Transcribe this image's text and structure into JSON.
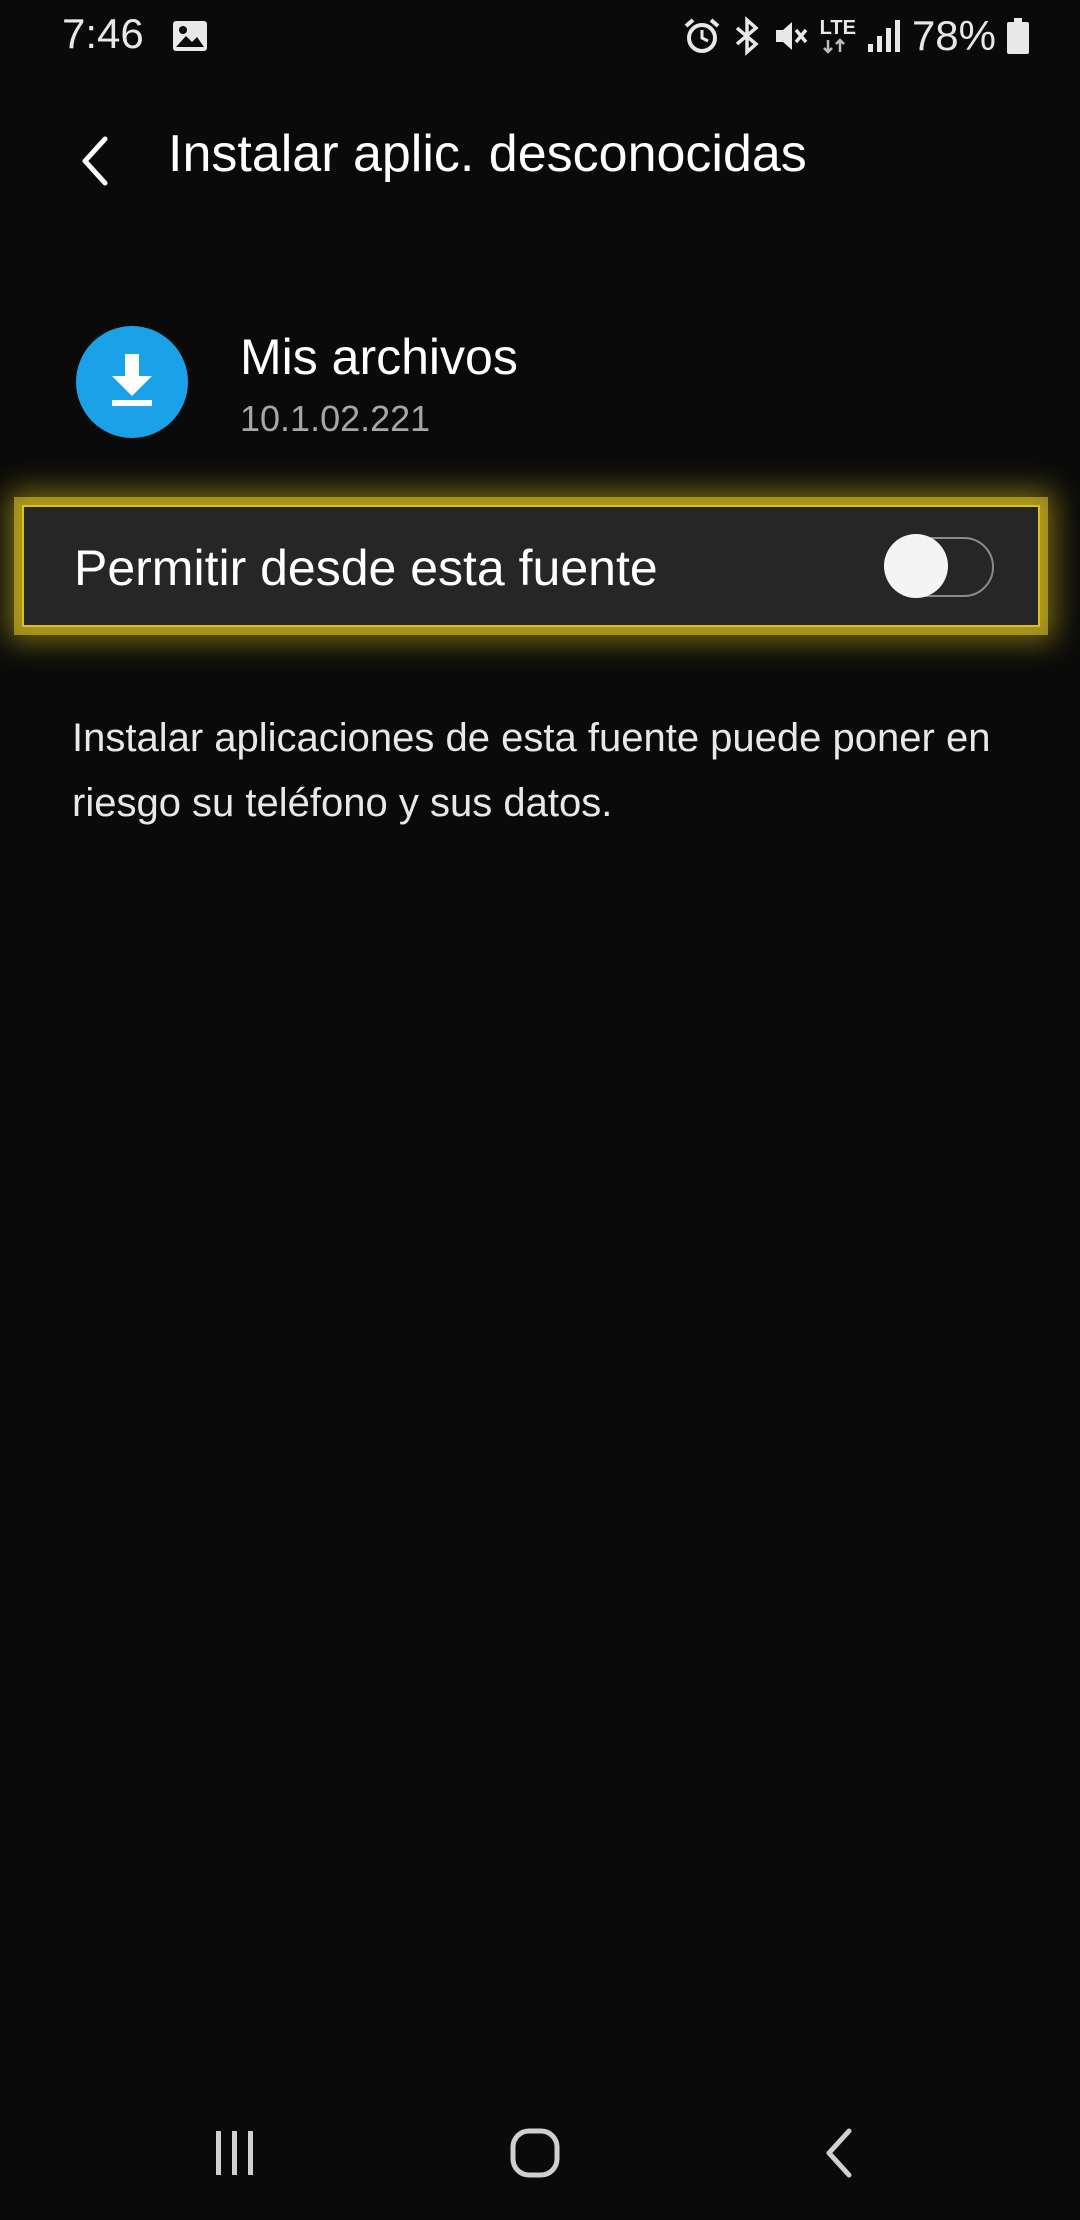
{
  "status_bar": {
    "time": "7:46",
    "network": "LTE",
    "battery": "78%",
    "icons": [
      "gallery-icon",
      "alarm-icon",
      "bluetooth-icon",
      "mute-icon",
      "lte-icon",
      "signal-icon",
      "battery-icon"
    ]
  },
  "header": {
    "title": "Instalar aplic. desconocidas",
    "back_icon": "back-arrow-icon"
  },
  "app": {
    "name": "Mis archivos",
    "version": "10.1.02.221",
    "icon": "download-icon",
    "icon_color": "#1ba1e8"
  },
  "permission": {
    "label": "Permitir desde esta fuente",
    "enabled": false,
    "highlight_color": "#d8c21e"
  },
  "warning": {
    "text": "Instalar aplicaciones de esta fuente puede poner en riesgo su teléfono y sus datos."
  },
  "nav_bar": {
    "items": [
      "recents-icon",
      "home-icon",
      "back-icon"
    ]
  }
}
